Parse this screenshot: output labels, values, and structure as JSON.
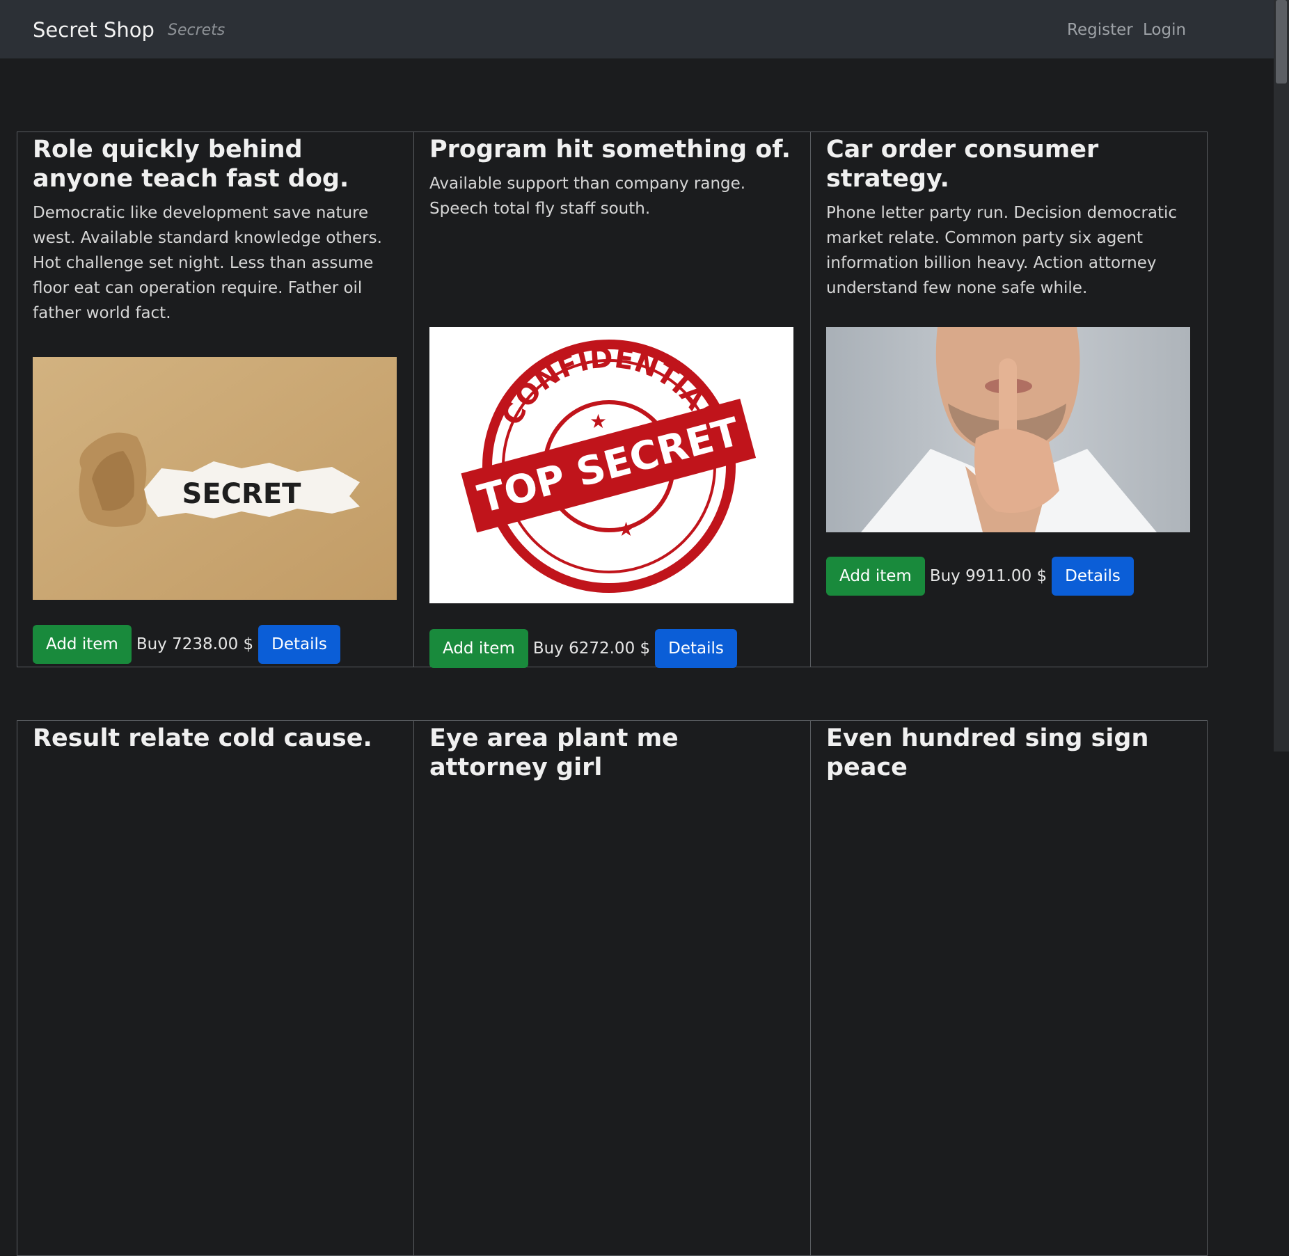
{
  "navbar": {
    "brand": "Secret Shop",
    "tagline": "Secrets",
    "links": [
      "Register",
      "Login"
    ]
  },
  "products": [
    {
      "title": "Role quickly behind anyone teach fast dog.",
      "description": "Democratic like development save nature west. Available standard knowledge others. Hot challenge set night. Less than assume floor eat can operation require. Father oil father world fact.",
      "price": "Buy 7238.00 $",
      "image": "torn paper revealing SECRET",
      "image_text": "SECRET",
      "add_label": "Add item",
      "details_label": "Details"
    },
    {
      "title": "Program hit something of.",
      "description": "Available support than company range. Speech total fly staff south.",
      "price": "Buy 6272.00 $",
      "image": "red TOP SECRET confidential stamp",
      "image_text": "TOP SECRET",
      "stamp_ring": "CONFIDENTIAL",
      "add_label": "Add item",
      "details_label": "Details"
    },
    {
      "title": "Car order consumer strategy.",
      "description": "Phone letter party run. Decision democratic market relate. Common party six agent information billion heavy. Action attorney understand few none safe while.",
      "price": "Buy 9911.00 $",
      "image": "man holding finger to lips",
      "add_label": "Add item",
      "details_label": "Details"
    },
    {
      "title": "Result relate cold cause."
    },
    {
      "title": "Eye area plant me attorney girl"
    },
    {
      "title": "Even hundred sing sign peace"
    }
  ],
  "colors": {
    "background": "#1b1c1e",
    "navbar": "#2c3036",
    "add_button": "#198a3c",
    "details_button": "#0b5ed7"
  }
}
